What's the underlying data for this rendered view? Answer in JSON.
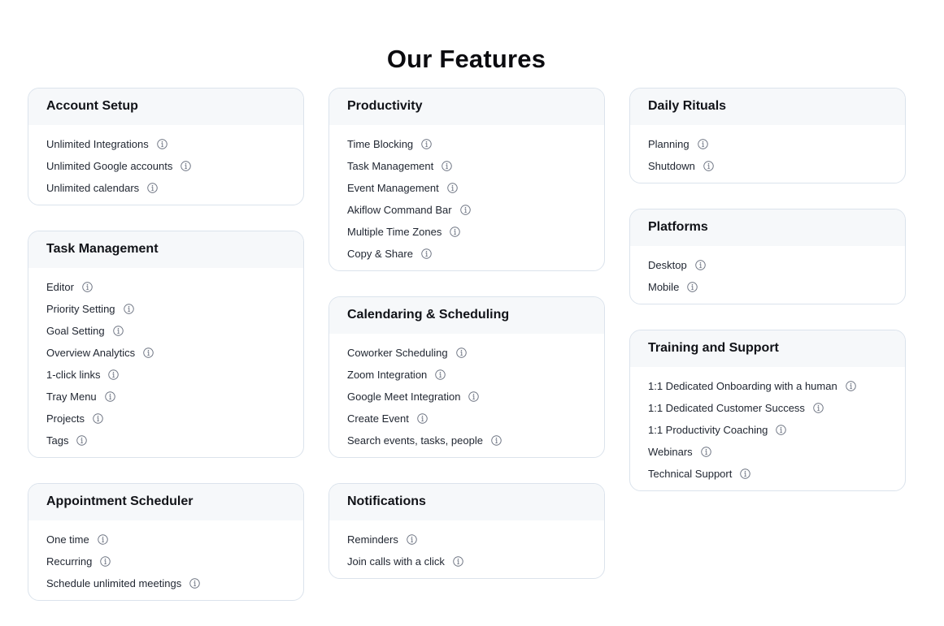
{
  "page": {
    "title": "Our Features"
  },
  "columns": [
    [
      {
        "title": "Account Setup",
        "items": [
          "Unlimited Integrations",
          "Unlimited Google accounts",
          "Unlimited calendars"
        ]
      },
      {
        "title": "Task Management",
        "items": [
          "Editor",
          "Priority Setting",
          "Goal Setting",
          "Overview Analytics",
          "1-click links",
          "Tray Menu",
          "Projects",
          "Tags"
        ]
      },
      {
        "title": "Appointment Scheduler",
        "items": [
          "One time",
          "Recurring",
          "Schedule unlimited meetings"
        ]
      }
    ],
    [
      {
        "title": "Productivity",
        "items": [
          "Time Blocking",
          "Task Management",
          "Event Management",
          "Akiflow Command Bar",
          "Multiple Time Zones",
          "Copy & Share"
        ]
      },
      {
        "title": "Calendaring & Scheduling",
        "items": [
          "Coworker Scheduling",
          "Zoom Integration",
          "Google Meet Integration",
          "Create Event",
          "Search events, tasks, people"
        ]
      },
      {
        "title": "Notifications",
        "items": [
          "Reminders",
          "Join calls with a click"
        ]
      }
    ],
    [
      {
        "title": "Daily Rituals",
        "items": [
          "Planning",
          "Shutdown"
        ]
      },
      {
        "title": "Platforms",
        "items": [
          "Desktop",
          "Mobile"
        ]
      },
      {
        "title": "Training and Support",
        "items": [
          "1:1 Dedicated Onboarding with a human",
          "1:1 Dedicated Customer Success",
          "1:1 Productivity Coaching",
          "Webinars",
          "Technical Support"
        ]
      }
    ]
  ],
  "icons": {
    "info": "info-circle-icon"
  },
  "colors": {
    "border": "#dbe3ec",
    "header_bg": "#f6f8fa",
    "icon": "#6b7280"
  }
}
